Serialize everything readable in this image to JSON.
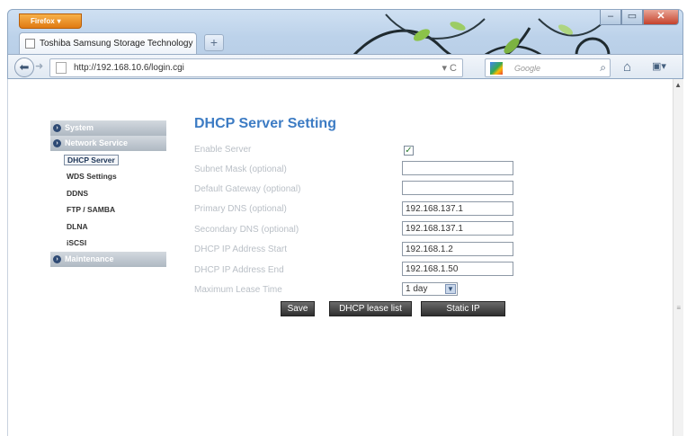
{
  "browser": {
    "menu_label": "Firefox",
    "tab_title": "Toshiba Samsung Storage Technology",
    "url": "http://192.168.10.6/login.cgi",
    "search_placeholder": "Google"
  },
  "sidebar": {
    "sections": [
      {
        "label": "System"
      },
      {
        "label": "Network Service"
      },
      {
        "label": "Maintenance"
      }
    ],
    "items": [
      {
        "label": "DHCP Server",
        "active": true
      },
      {
        "label": "WDS Settings"
      },
      {
        "label": "DDNS"
      },
      {
        "label": "FTP / SAMBA"
      },
      {
        "label": "DLNA"
      },
      {
        "label": "iSCSI"
      }
    ]
  },
  "form": {
    "title": "DHCP Server Setting",
    "fields": [
      {
        "label": "Enable Server",
        "checked": true
      },
      {
        "label": "Subnet Mask (optional)",
        "value": ""
      },
      {
        "label": "Default Gateway (optional)",
        "value": ""
      },
      {
        "label": "Primary DNS (optional)",
        "value": "192.168.137.1"
      },
      {
        "label": "Secondary DNS (optional)",
        "value": "192.168.137.1"
      },
      {
        "label": "DHCP IP Address Start",
        "value": "192.168.1.2"
      },
      {
        "label": "DHCP IP Address End",
        "value": "192.168.1.50"
      },
      {
        "label": "Maximum Lease Time",
        "value": "1 day"
      }
    ],
    "buttons": {
      "save": "Save",
      "lease_list": "DHCP lease list",
      "static_ip": "Static IP"
    }
  },
  "colors": {
    "title": "#3d7cc4",
    "label": "#b9bfc6",
    "button": "#3a3a3a",
    "sidebar_header": "#aeb8c2"
  }
}
